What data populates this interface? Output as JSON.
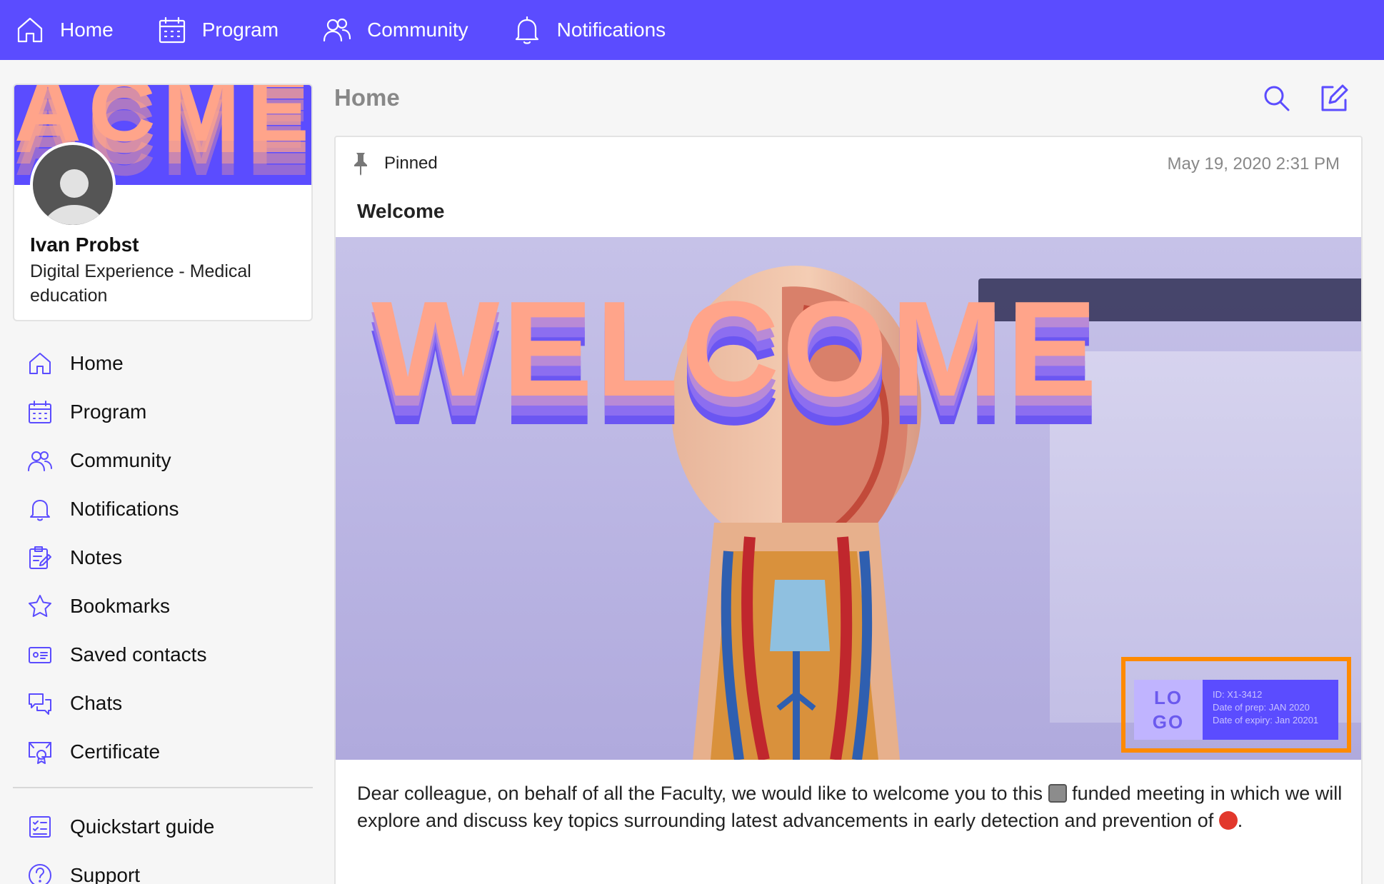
{
  "topnav": {
    "items": [
      {
        "label": "Home",
        "icon": "home-icon"
      },
      {
        "label": "Program",
        "icon": "calendar-icon"
      },
      {
        "label": "Community",
        "icon": "people-icon"
      },
      {
        "label": "Notifications",
        "icon": "bell-icon"
      }
    ]
  },
  "profile": {
    "banner_text": "ACME",
    "name": "Ivan Probst",
    "role": "Digital Experience - Medical education"
  },
  "sidebar": {
    "items": [
      {
        "label": "Home",
        "icon": "home-icon"
      },
      {
        "label": "Program",
        "icon": "calendar-icon"
      },
      {
        "label": "Community",
        "icon": "people-icon"
      },
      {
        "label": "Notifications",
        "icon": "bell-icon"
      },
      {
        "label": "Notes",
        "icon": "notes-icon"
      },
      {
        "label": "Bookmarks",
        "icon": "star-icon"
      },
      {
        "label": "Saved contacts",
        "icon": "contact-card-icon"
      },
      {
        "label": "Chats",
        "icon": "chat-icon"
      },
      {
        "label": "Certificate",
        "icon": "certificate-icon"
      }
    ],
    "secondary": [
      {
        "label": "Quickstart guide",
        "icon": "checklist-icon"
      },
      {
        "label": "Support",
        "icon": "help-icon"
      }
    ]
  },
  "main": {
    "title": "Home",
    "search_icon": "search-icon",
    "compose_icon": "compose-icon"
  },
  "post": {
    "pinned_label": "Pinned",
    "date": "May 19, 2020 2:31 PM",
    "title": "Welcome",
    "image": {
      "headline": "WELCOME",
      "logo_text_1": "LO",
      "logo_text_2": "GO",
      "info_line_1": "ID: X1-3412",
      "info_line_2": "Date of prep: JAN 2020",
      "info_line_3": "Date of expiry: Jan 20201"
    },
    "body_part_1": "Dear colleague, on behalf of all the Faculty, we would like to welcome you to this",
    "body_part_2": "funded meeting in which we will explore and discuss key topics surrounding latest advancements in early detection and prevention of",
    "body_part_3": "."
  },
  "colors": {
    "brand": "#5b4cff",
    "accent": "#ffa48a",
    "highlight": "#ff8a00"
  }
}
